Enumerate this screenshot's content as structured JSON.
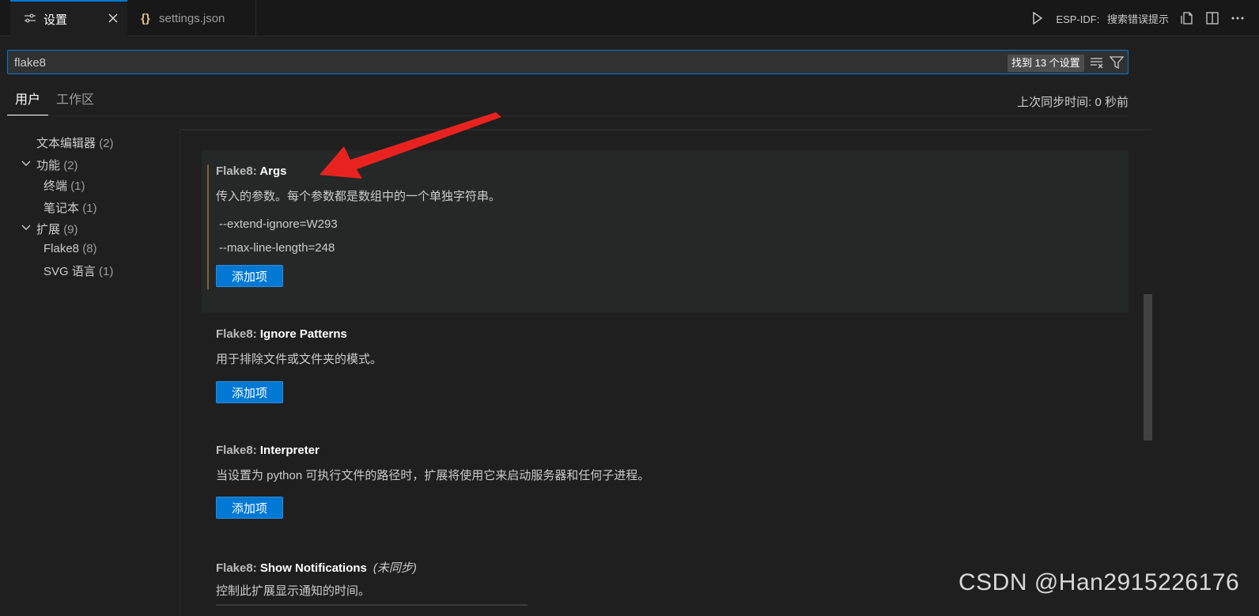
{
  "tabs": [
    {
      "label": "设置",
      "icon": "settings-sliders-icon",
      "active": true
    },
    {
      "label": "settings.json",
      "icon": "json-braces-icon",
      "active": false
    }
  ],
  "editor_actions": {
    "esp_idf_label": "ESP-IDF:",
    "esp_idf_action": "搜索错误提示"
  },
  "search": {
    "value": "flake8",
    "result_count": "找到 13 个设置"
  },
  "scope": {
    "user_tab": "用户",
    "workspace_tab": "工作区",
    "sync_time": "上次同步时间: 0 秒前"
  },
  "toc": [
    {
      "label": "文本编辑器",
      "count": "(2)",
      "expanded": null
    },
    {
      "label": "功能",
      "count": "(2)",
      "expanded": true
    },
    {
      "label": "终端",
      "count": "(1)",
      "expanded": null
    },
    {
      "label": "笔记本",
      "count": "(1)",
      "expanded": null
    },
    {
      "label": "扩展",
      "count": "(9)",
      "expanded": true
    },
    {
      "label": "Flake8",
      "count": "(8)",
      "expanded": null
    },
    {
      "label": "SVG 语言",
      "count": "(1)",
      "expanded": null
    }
  ],
  "settings": [
    {
      "category": "Flake8: ",
      "name": "Args",
      "description": "传入的参数。每个参数都是数组中的一个单独字符串。",
      "values": [
        "--extend-ignore=W293",
        "--max-line-length=248"
      ],
      "button": "添加项"
    },
    {
      "category": "Flake8: ",
      "name": "Ignore Patterns",
      "description": "用于排除文件或文件夹的模式。",
      "button": "添加项"
    },
    {
      "category": "Flake8: ",
      "name": "Interpreter",
      "description": "当设置为 python 可执行文件的路径时，扩展将使用它来启动服务器和任何子进程。",
      "button": "添加项"
    },
    {
      "category": "Flake8: ",
      "name": "Show Notifications",
      "note": "(未同步)",
      "description": "控制此扩展显示通知的时间。"
    }
  ],
  "watermark": "CSDN @Han2915226176",
  "colors": {
    "accent": "#0078d4",
    "annotation_arrow": "#e8231f",
    "background": "#1f1f1f",
    "focus_bar": "#7d6432"
  }
}
